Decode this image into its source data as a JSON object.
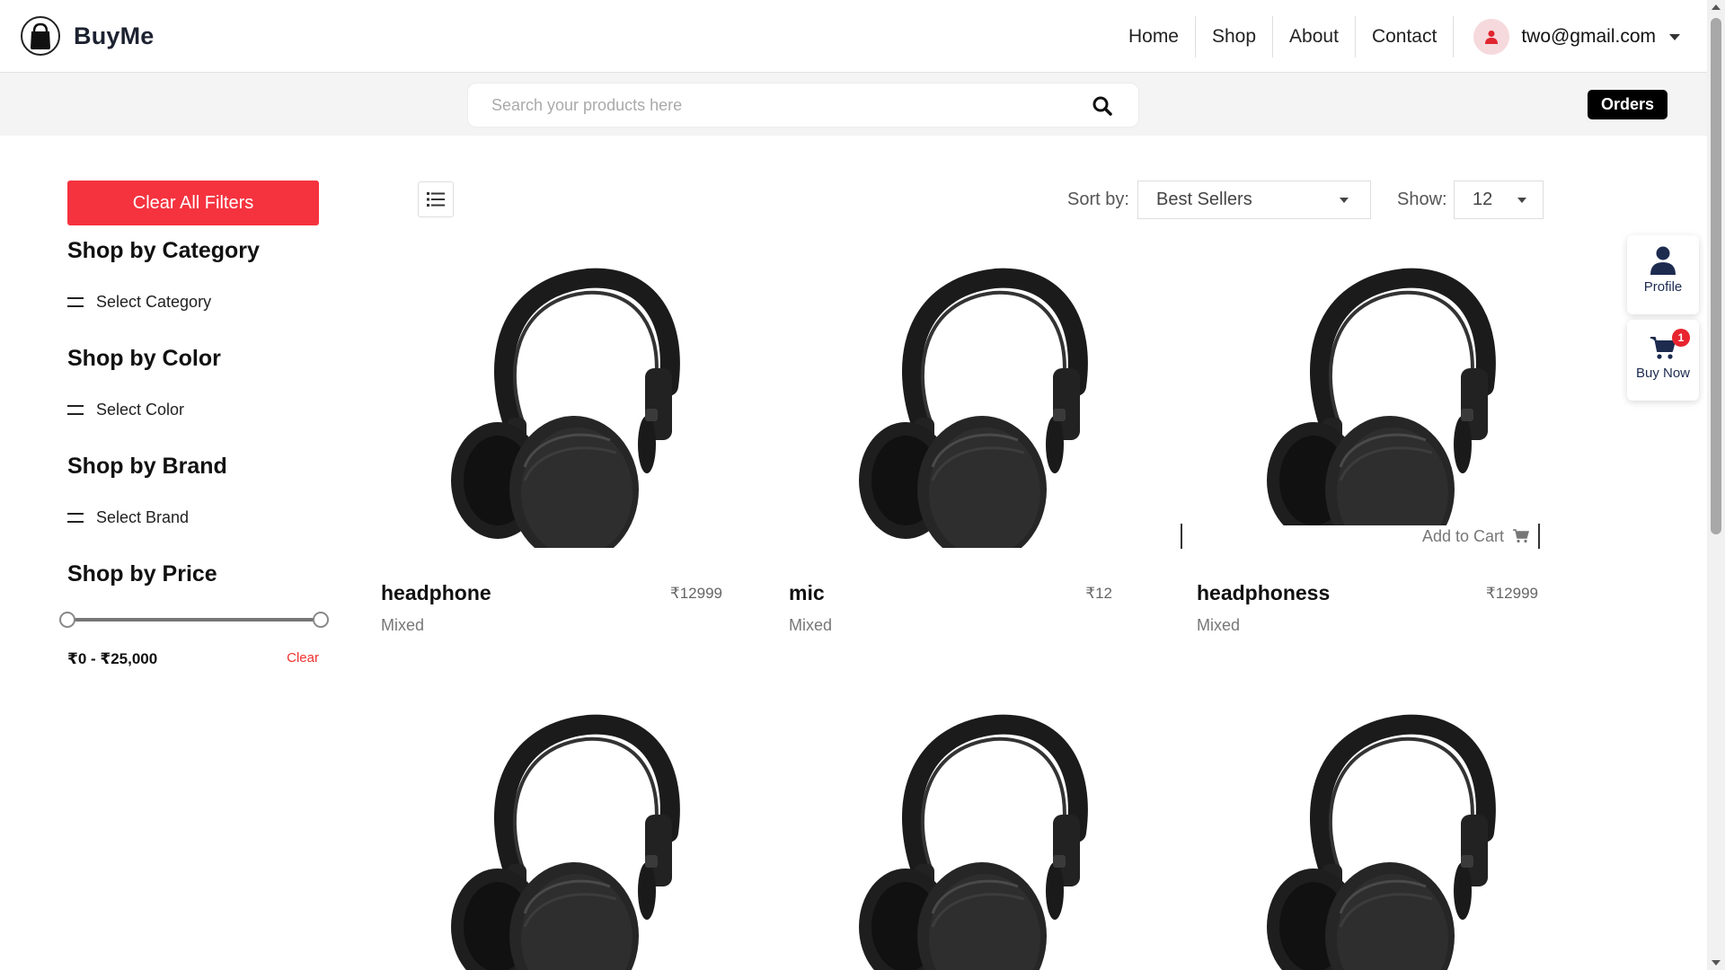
{
  "brand": {
    "name": "BuyMe",
    "logo_icon": "shopping-bag-icon"
  },
  "nav": {
    "links": [
      "Home",
      "Shop",
      "About",
      "Contact"
    ],
    "user_email": "two@gmail.com",
    "user_icon": "user-icon"
  },
  "search": {
    "placeholder": "Search your products here",
    "icon": "search-icon"
  },
  "orders_label": "Orders",
  "sidebar": {
    "clear_all_label": "Clear All Filters",
    "category_heading": "Shop by Category",
    "category_select": "Select Category",
    "color_heading": "Shop by Color",
    "color_select": "Select Color",
    "brand_heading": "Shop by Brand",
    "brand_select": "Select Brand",
    "price_heading": "Shop by Price",
    "price_range_label": "₹0 - ₹25,000",
    "price_clear_label": "Clear",
    "price_min_fraction": 0.0,
    "price_max_fraction": 1.0
  },
  "toolbar": {
    "view_icon": "list-view-icon",
    "sort_label": "Sort by:",
    "sort_value": "Best Sellers",
    "show_label": "Show:",
    "show_value": "12"
  },
  "products": [
    {
      "name": "headphone",
      "price": "₹12999",
      "tag": "Mixed"
    },
    {
      "name": "mic",
      "price": "₹12",
      "tag": "Mixed"
    },
    {
      "name": "headphoness",
      "price": "₹12999",
      "tag": "Mixed",
      "add_to_cart": "Add to Cart"
    },
    {
      "name": "",
      "price": "",
      "tag": ""
    },
    {
      "name": "",
      "price": "",
      "tag": ""
    },
    {
      "name": "",
      "price": "",
      "tag": ""
    }
  ],
  "floating": {
    "profile_label": "Profile",
    "profile_icon": "user-icon",
    "buy_now_label": "Buy Now",
    "cart_icon": "cart-icon",
    "cart_count": "1"
  },
  "colors": {
    "accent_red": "#f5333f",
    "orders_bg": "#000000",
    "badge_red": "#e8242f",
    "navy": "#1d2b4f"
  }
}
